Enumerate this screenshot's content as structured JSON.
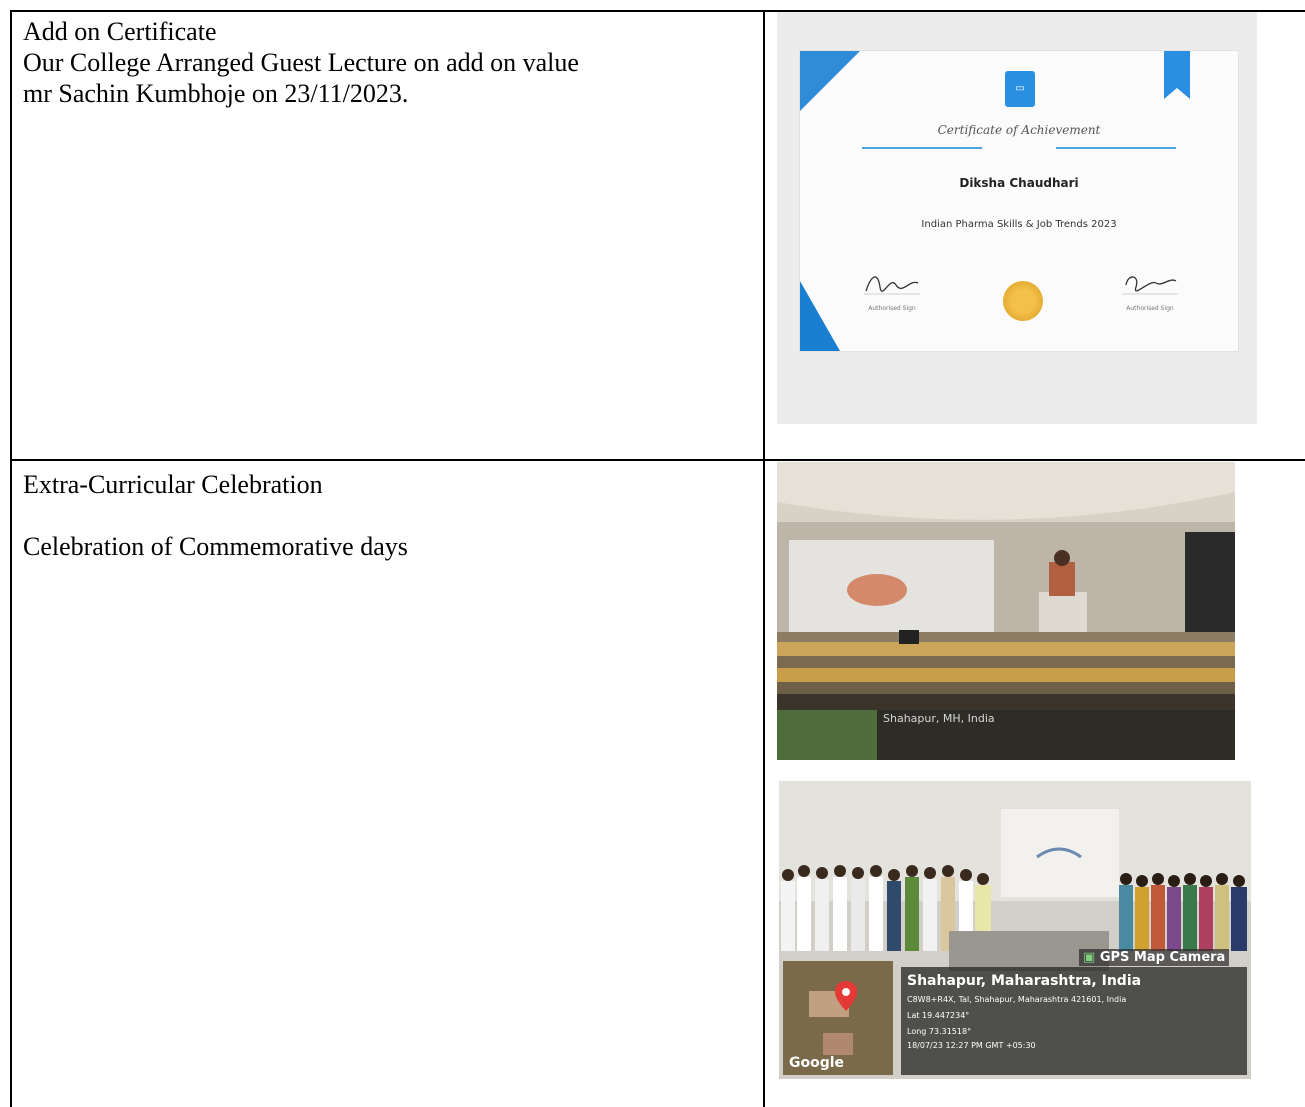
{
  "row1": {
    "heading": "Add on Certificate",
    "line1": "Our College Arranged Guest Lecture on add on value",
    "line2": "mr Sachin Kumbhoje on 23/11/2023."
  },
  "row2": {
    "heading": "Extra-Curricular Celebration",
    "subheading": "Celebration of Commemorative days"
  },
  "certificate": {
    "title": "Certificate of Achievement",
    "name": "Diksha Chaudhari",
    "course": "Indian Pharma Skills & Job Trends 2023",
    "sign_label_left": "Authorised Sign",
    "sign_label_right": "Authorised Sign"
  },
  "photo2_overlay": {
    "app": "GPS Map Camera",
    "location": "Shahapur, Maharashtra, India",
    "address": "C8W8+R4X, Tal, Shahapur, Maharashtra 421601, India",
    "lat": "Lat 19.447234°",
    "long": "Long 73.31518°",
    "datetime": "18/07/23 12:27 PM GMT +05:30",
    "google": "Google"
  },
  "photo1_overlay": {
    "location": "Shahapur, MH, India"
  }
}
